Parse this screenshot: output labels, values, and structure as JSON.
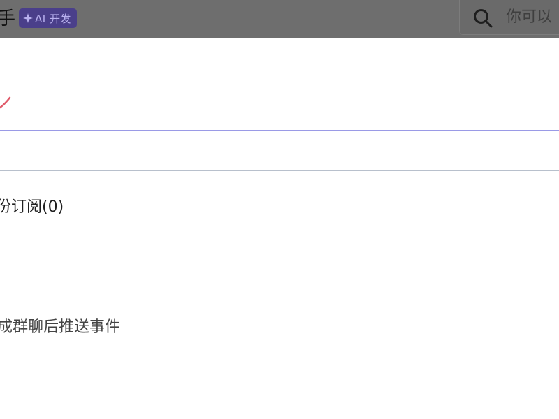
{
  "header": {
    "title": "手",
    "badge": {
      "label": "AI 开发",
      "icon": "sparkle-icon"
    },
    "search": {
      "placeholder": "你可以",
      "icon": "search-icon"
    }
  },
  "main": {
    "subscription_tab": "份订阅(0)",
    "event_description": "成群聊后推送事件"
  },
  "colors": {
    "topbar": "#6e6e6e",
    "badge_bg": "#4a3f8a",
    "divider_accent": "#9a9ae6",
    "accent_mark": "#e05a6a"
  }
}
